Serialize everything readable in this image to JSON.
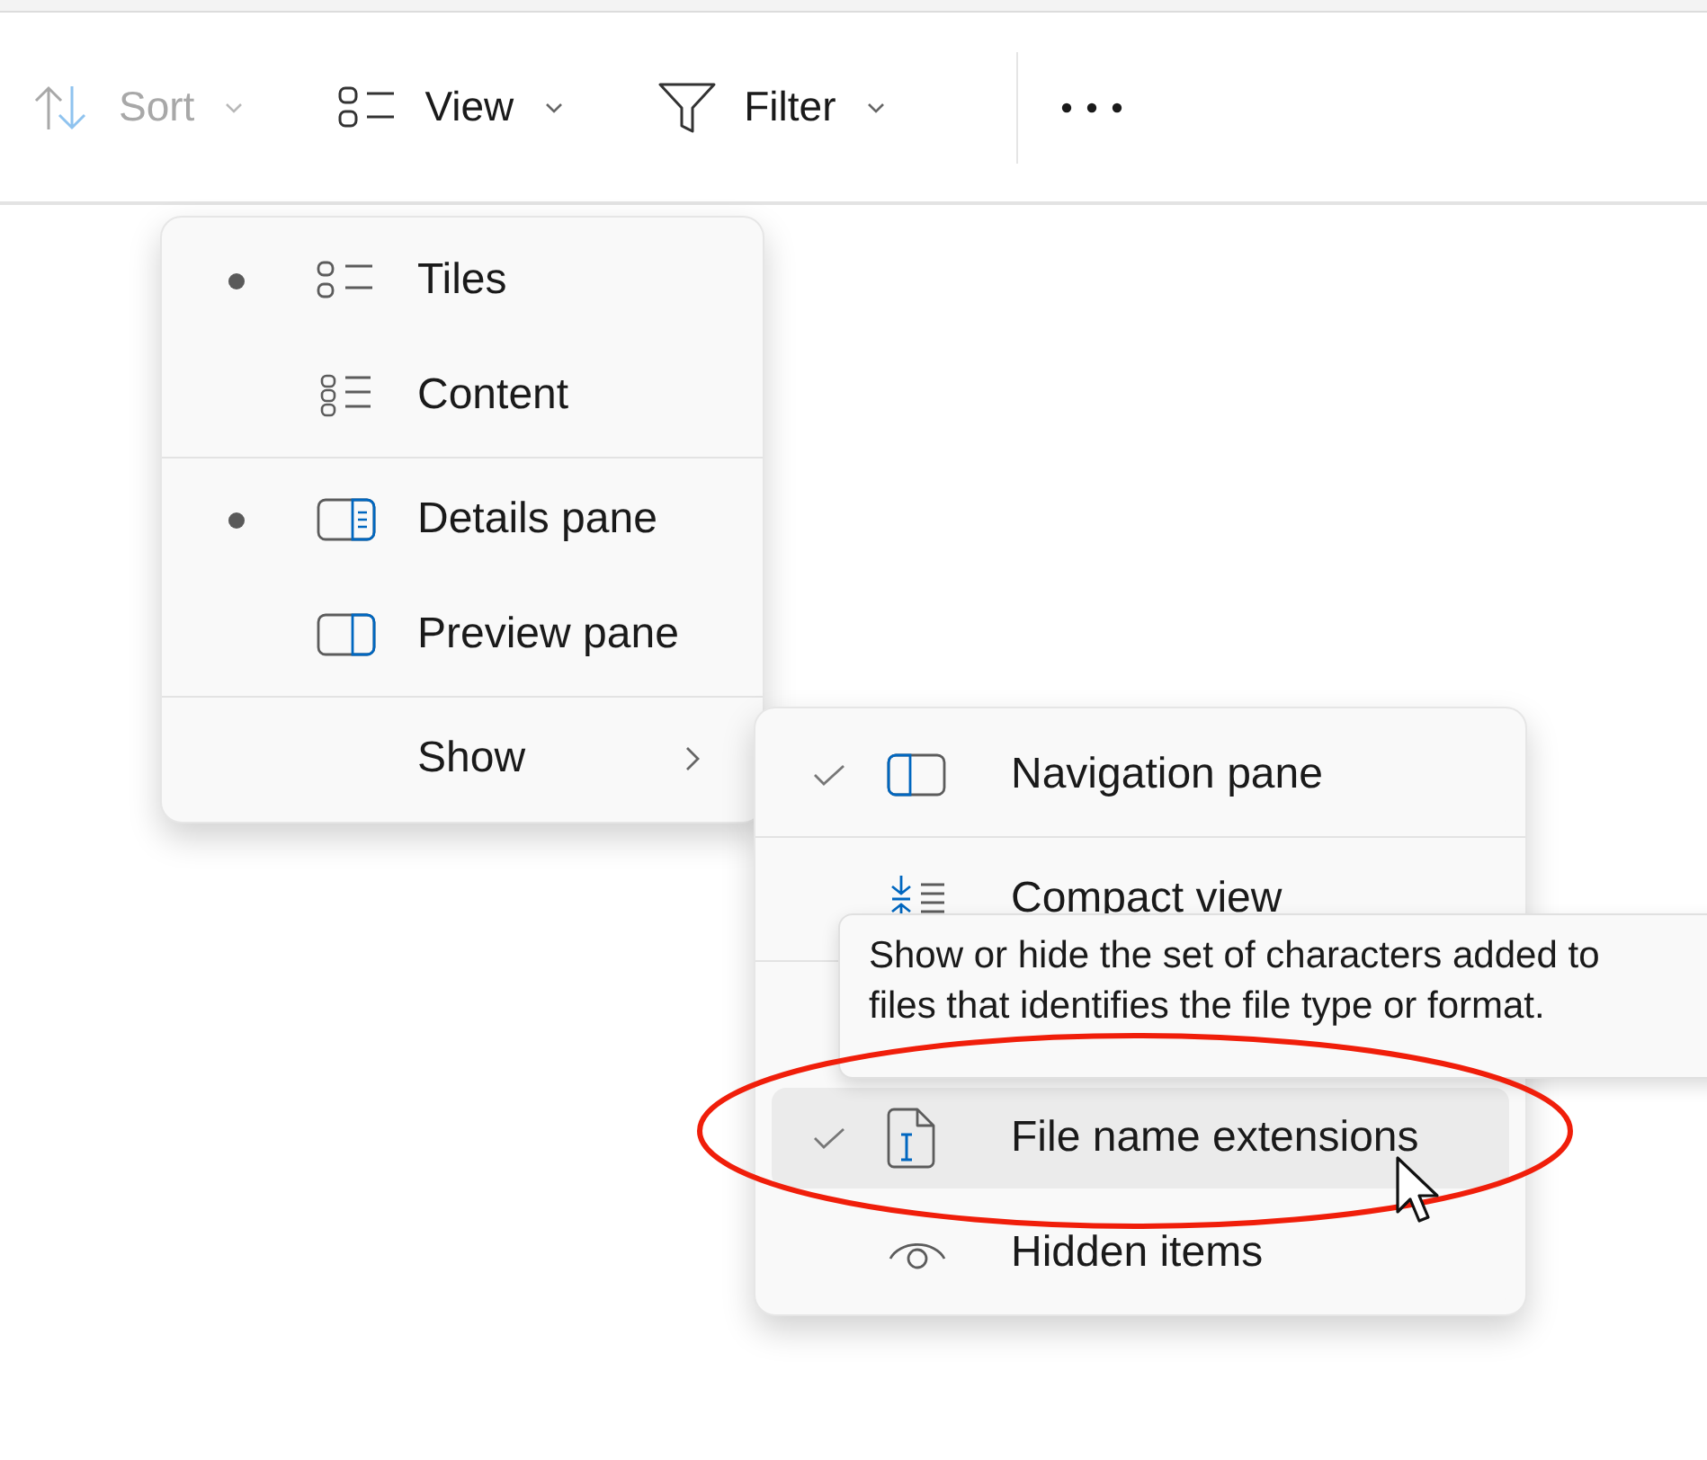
{
  "toolbar": {
    "buttons": [
      {
        "kind": "sort",
        "label": "Sort",
        "disabled": true
      },
      {
        "kind": "view",
        "label": "View",
        "disabled": false
      },
      {
        "kind": "filter",
        "label": "Filter",
        "disabled": false
      },
      {
        "kind": "more"
      }
    ]
  },
  "view_menu": {
    "sections": [
      {
        "items": [
          {
            "kind": "tiles",
            "label": "Tiles",
            "selected": true
          },
          {
            "kind": "content",
            "label": "Content",
            "selected": false
          }
        ]
      },
      {
        "items": [
          {
            "kind": "details-pane",
            "label": "Details pane",
            "selected": true
          },
          {
            "kind": "preview-pane",
            "label": "Preview pane",
            "selected": false
          }
        ]
      },
      {
        "items": [
          {
            "kind": "submenu",
            "label": "Show",
            "selected": false
          }
        ]
      }
    ]
  },
  "show_menu": {
    "sections": [
      {
        "items": [
          {
            "kind": "navigation-pane",
            "label": "Navigation pane",
            "checked": true,
            "highlighted": false
          }
        ]
      },
      {
        "items": [
          {
            "kind": "compact",
            "label": "Compact view",
            "checked": false,
            "highlighted": false
          }
        ]
      },
      {
        "items": [
          {
            "kind": "hidden-row"
          }
        ]
      },
      {
        "items": [
          {
            "kind": "extensions",
            "label": "File name extensions",
            "checked": true,
            "highlighted": true
          },
          {
            "kind": "hidden-items",
            "label": "Hidden items",
            "checked": false,
            "highlighted": false
          }
        ]
      }
    ]
  },
  "tooltip": {
    "text": "Show or hide the set of characters added to files that identifies the file type or format."
  }
}
